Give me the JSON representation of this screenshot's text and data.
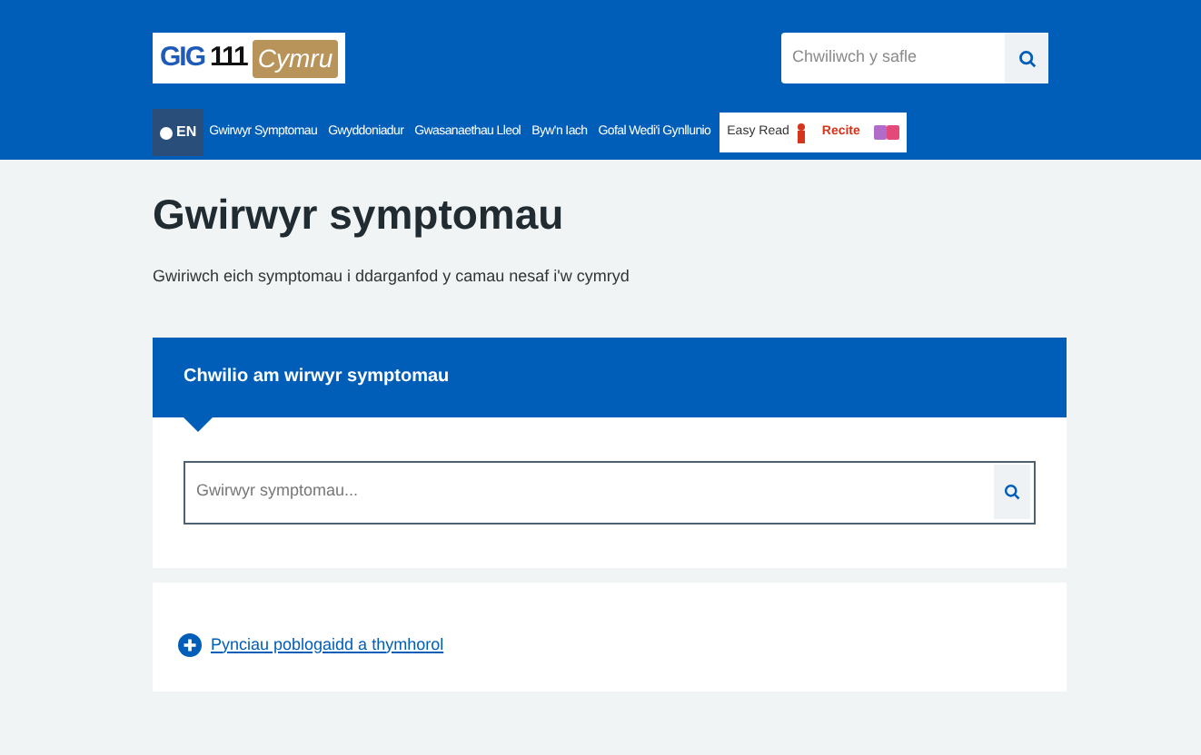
{
  "header": {
    "logo": {
      "prefix": "GIG",
      "number": "111",
      "suffix": "Cymru"
    },
    "search": {
      "placeholder": "Chwiliwch y safle"
    }
  },
  "nav": {
    "language": {
      "label": "EN",
      "selected": true
    },
    "items": [
      {
        "label": "Gwirwyr Symptomau"
      },
      {
        "label": "Gwyddoniadur"
      },
      {
        "label": "Gwasanaethau Lleol"
      },
      {
        "label": "Byw'n Iach"
      },
      {
        "label": "Gofal Wedi'i Gynllunio"
      }
    ],
    "tools": {
      "easy_read": "Easy Read",
      "recite": "Recite"
    }
  },
  "page": {
    "title": "Gwirwyr symptomau",
    "intro": "Gwiriwch eich symptomau i ddarganfod y camau nesaf i'w cymryd"
  },
  "search_panel": {
    "heading": "Chwilio am wirwyr symptomau",
    "placeholder": "Gwirwyr symptomau..."
  },
  "topics": {
    "label": "Pynciau poblogaidd a thymhorol",
    "expanded": false
  }
}
